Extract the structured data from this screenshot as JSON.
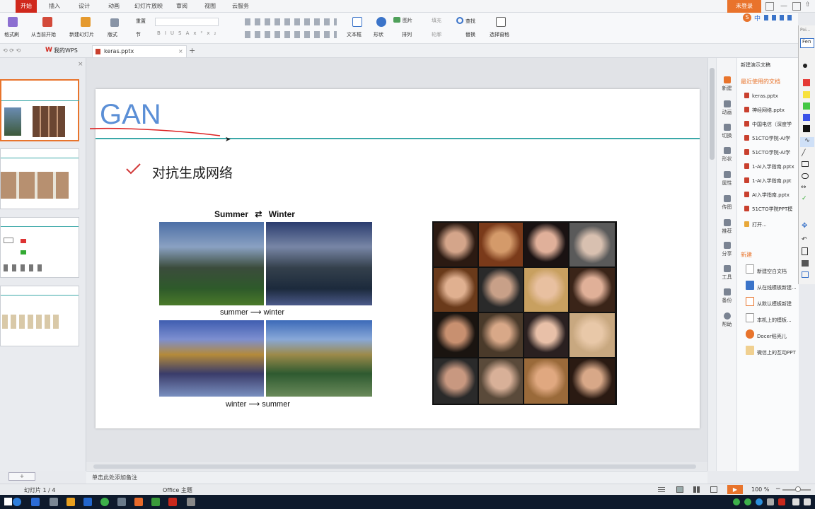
{
  "menu": {
    "tabs": [
      "开始",
      "插入",
      "设计",
      "动画",
      "幻灯片放映",
      "审阅",
      "视图",
      "云服务"
    ],
    "active_tab": "开始",
    "login_button": "未登录",
    "ime_label": "中"
  },
  "toolbar": {
    "format_painter": "格式刷",
    "from_current": "从当前开始",
    "new_slide": "新建幻灯片",
    "layout": "版式",
    "section": "节",
    "reset": "重置",
    "text_box": "文本框",
    "shape": "形状",
    "picture": "图片",
    "fill": "填充",
    "arrange": "排列",
    "outline": "轮廓",
    "find": "查找",
    "replace": "替换",
    "select_pane": "选择窗格",
    "font_buttons": [
      "B",
      "I",
      "U",
      "S",
      "A",
      "x²",
      "x₂"
    ]
  },
  "tabs": {
    "items": [
      {
        "label": "我的WPS"
      },
      {
        "label": "keras.pptx"
      }
    ],
    "add_tab": "+"
  },
  "slide": {
    "title": "GAN",
    "bullet_text": "对抗生成网络",
    "left_figure": {
      "header_left": "Summer",
      "header_right": "Winter",
      "caption_top_from": "summer",
      "caption_top_to": "winter",
      "caption_bottom_from": "winter",
      "caption_bottom_to": "summer",
      "arrow": "⟶"
    },
    "accent_color": "#3aa8a8",
    "title_color": "#5b8fd6"
  },
  "right_panel": {
    "new_doc_menu": "新建演示文稿",
    "recent_header": "最近使用的文档",
    "recent_files": [
      "keras.pptx",
      "神经网络.pptx",
      "中国电信（深度学",
      "51CTO学院-AI学",
      "51CTO学院-AI学",
      "1-AI入学指南.pptx",
      "1-AI入学指南.ppt",
      "AI入学指南.pptx",
      "51CTO学院PPT模"
    ],
    "open": "打开...",
    "new_header": "新建",
    "new_items": [
      "新建空白文档",
      "从在线模板新建...",
      "从默认模板新建",
      "本机上的模板...",
      "Docer稻壳儿",
      "微信上的互动PPT"
    ]
  },
  "side_icons": [
    "新建",
    "动画",
    "切换",
    "形状",
    "属性",
    "传图",
    "推荐",
    "分享",
    "工具",
    "备份",
    "帮助"
  ],
  "palette": {
    "header": "Poi...",
    "font_box": "Fen"
  },
  "notes": {
    "placeholder": "单击此处添加备注"
  },
  "status": {
    "slide_info": "幻灯片 1 / 4",
    "theme": "Office 主题",
    "zoom": "100 %"
  }
}
